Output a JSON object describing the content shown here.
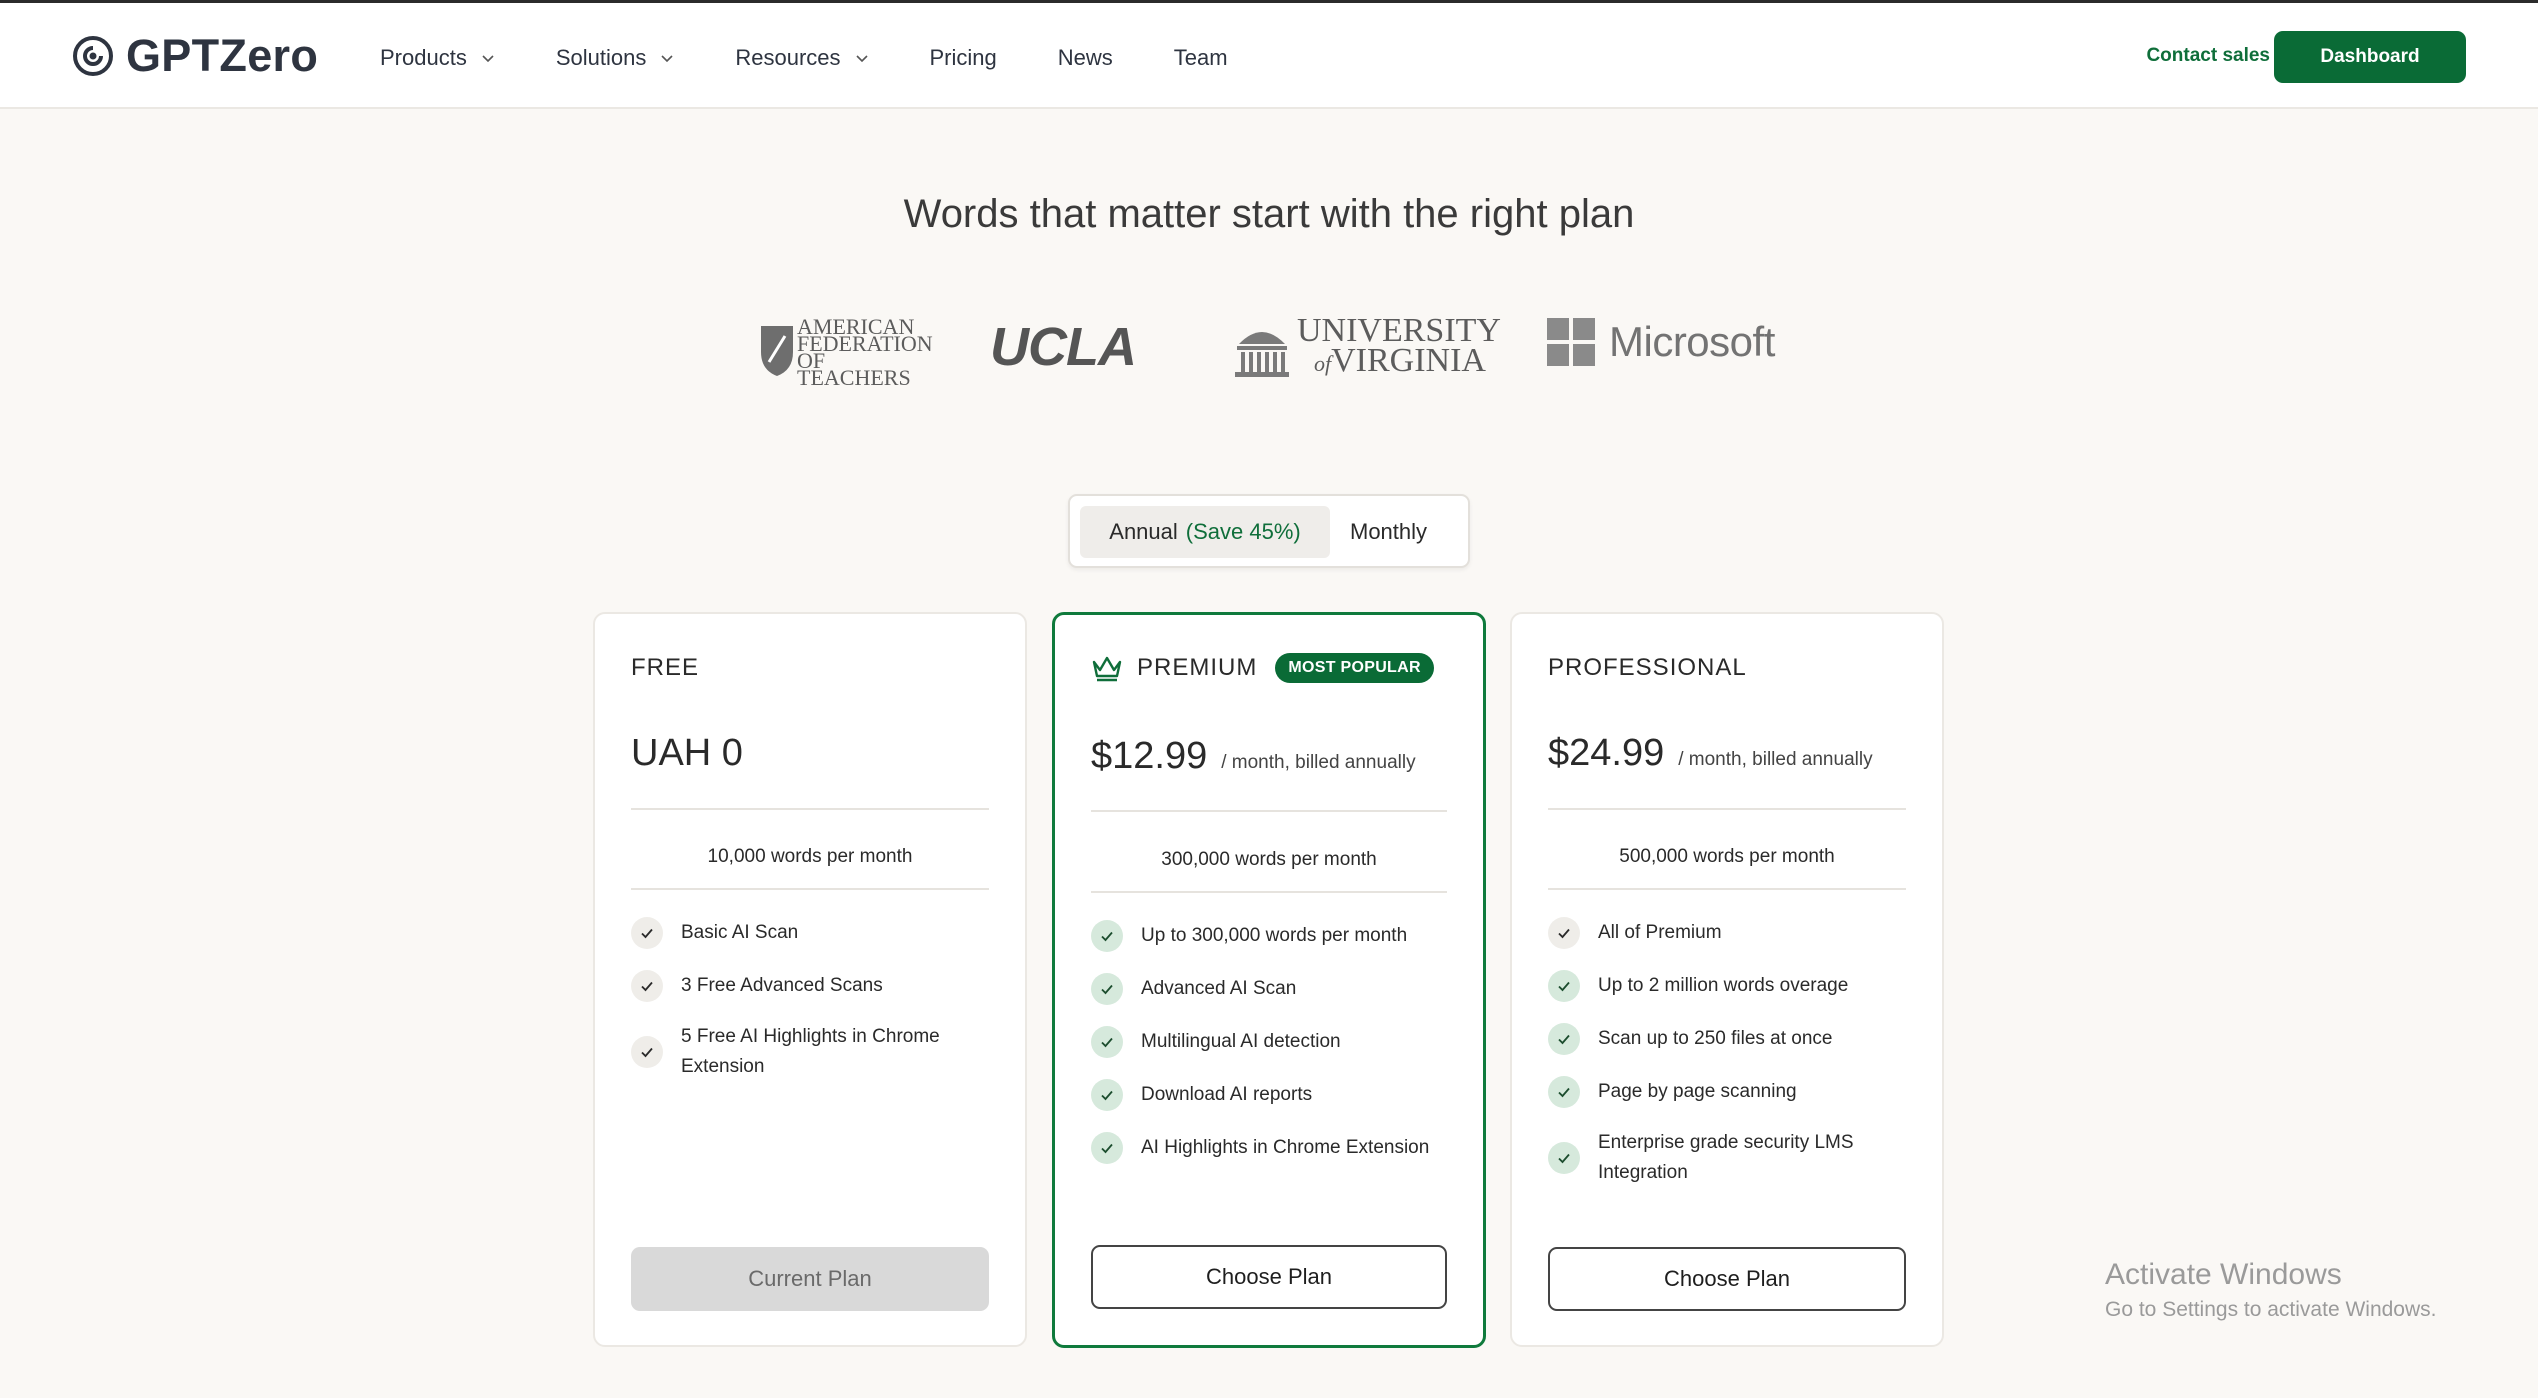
{
  "header": {
    "brand": "GPTZero",
    "nav": [
      {
        "label": "Products",
        "dropdown": true
      },
      {
        "label": "Solutions",
        "dropdown": true
      },
      {
        "label": "Resources",
        "dropdown": true
      },
      {
        "label": "Pricing",
        "dropdown": false
      },
      {
        "label": "News",
        "dropdown": false
      },
      {
        "label": "Team",
        "dropdown": false
      }
    ],
    "contact_label": "Contact sales",
    "dashboard_label": "Dashboard"
  },
  "hero": {
    "title": "Words that matter start with the right plan",
    "logos": {
      "aft": "American Federation of Teachers",
      "ucla": "UCLA",
      "uva": "University of Virginia",
      "microsoft": "Microsoft"
    }
  },
  "billing": {
    "annual_label": "Annual",
    "annual_save": "(Save 45%)",
    "monthly_label": "Monthly",
    "selected": "annual"
  },
  "plans": [
    {
      "name": "FREE",
      "price": "UAH 0",
      "per": "",
      "words": "10,000 words per month",
      "features": [
        "Basic AI Scan",
        "3 Free Advanced Scans",
        "5 Free AI Highlights in Chrome Extension"
      ],
      "button": "Current Plan"
    },
    {
      "name": "PREMIUM",
      "badge": "MOST POPULAR",
      "price": "$12.99",
      "per": "/ month, billed annually",
      "words": "300,000 words per month",
      "features": [
        "Up to 300,000 words per month",
        "Advanced AI Scan",
        "Multilingual AI detection",
        "Download AI reports",
        "AI Highlights in Chrome Extension"
      ],
      "button": "Choose Plan"
    },
    {
      "name": "PROFESSIONAL",
      "price": "$24.99",
      "per": "/ month, billed annually",
      "words": "500,000 words per month",
      "features": [
        "All of Premium",
        "Up to 2 million words overage",
        "Scan up to 250 files at once",
        "Page by page scanning",
        "Enterprise grade security LMS Integration"
      ],
      "button": "Choose Plan"
    }
  ],
  "watermark": {
    "title": "Activate Windows",
    "subtitle": "Go to Settings to activate Windows."
  },
  "colors": {
    "accent": "#0a6b36",
    "background": "#faf8f5",
    "check_bg": "#d6e9dc"
  }
}
